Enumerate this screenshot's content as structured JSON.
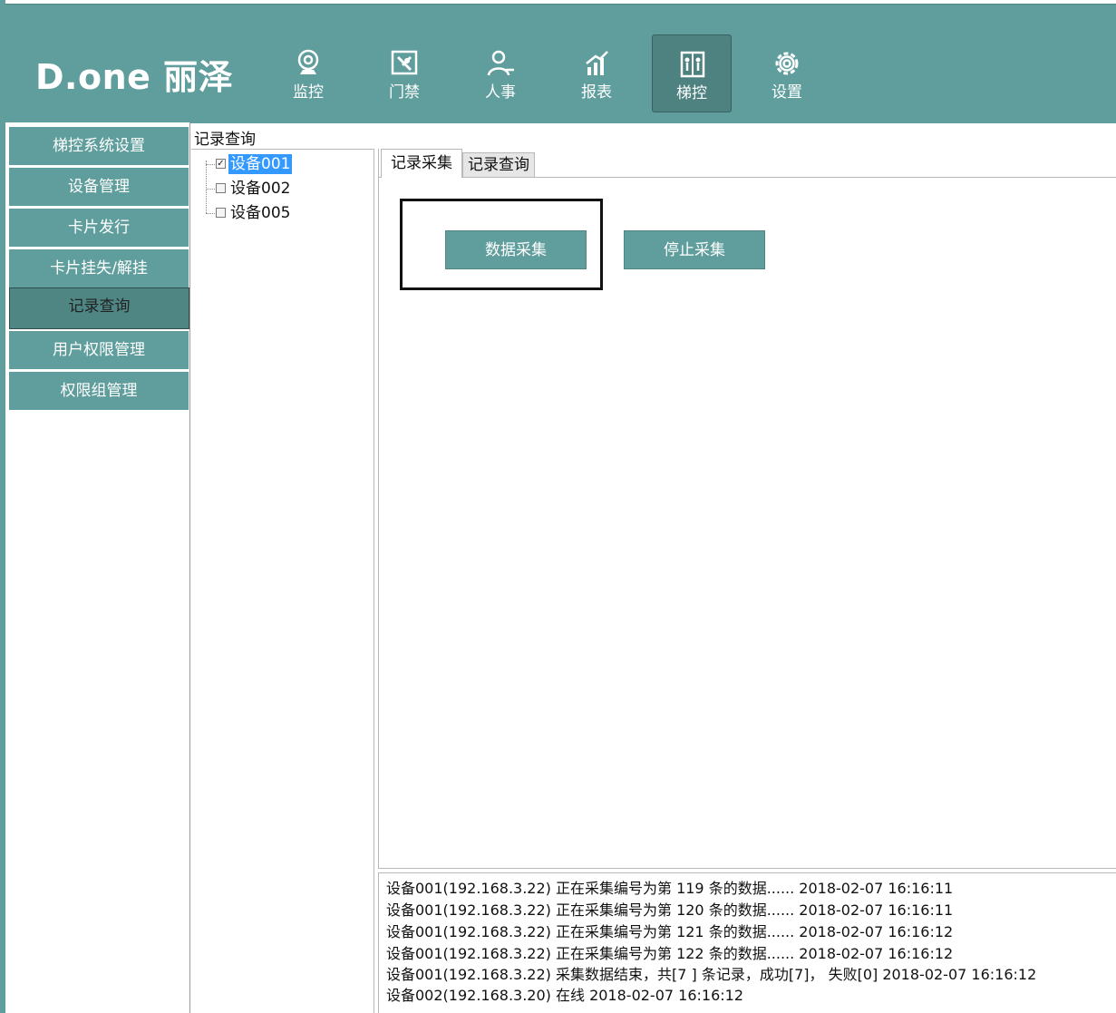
{
  "app": {
    "brand": "D.one 丽泽"
  },
  "nav": [
    {
      "label": "监控",
      "icon": "camera-icon"
    },
    {
      "label": "门禁",
      "icon": "door-access-icon"
    },
    {
      "label": "人事",
      "icon": "person-icon"
    },
    {
      "label": "报表",
      "icon": "bar-chart-icon"
    },
    {
      "label": "梯控",
      "icon": "elevator-icon"
    },
    {
      "label": "设置",
      "icon": "gear-icon"
    }
  ],
  "sidebar": {
    "items": [
      {
        "label": "梯控系统设置"
      },
      {
        "label": "设备管理"
      },
      {
        "label": "卡片发行"
      },
      {
        "label": "卡片挂失/解挂"
      },
      {
        "label": "记录查询"
      },
      {
        "label": "用户权限管理"
      },
      {
        "label": "权限组管理"
      }
    ],
    "active_index": 4
  },
  "panel": {
    "title": "记录查询"
  },
  "tree": {
    "items": [
      {
        "label": "设备001",
        "checked": true,
        "check_mark": "✓"
      },
      {
        "label": "设备002",
        "checked": false,
        "check_mark": ""
      },
      {
        "label": "设备005",
        "checked": false,
        "check_mark": ""
      }
    ]
  },
  "tabs": [
    {
      "label": "记录采集",
      "active": true
    },
    {
      "label": "记录查询",
      "active": false
    }
  ],
  "actions": {
    "collect_label": "数据采集",
    "stop_label": "停止采集"
  },
  "log": [
    "设备001(192.168.3.22) 正在采集编号为第 119 条的数据...... 2018-02-07 16:16:11",
    "设备001(192.168.3.22) 正在采集编号为第 120 条的数据...... 2018-02-07 16:16:11",
    "设备001(192.168.3.22) 正在采集编号为第 121 条的数据...... 2018-02-07 16:16:12",
    "设备001(192.168.3.22) 正在采集编号为第 122 条的数据...... 2018-02-07 16:16:12",
    "设备001(192.168.3.22) 采集数据结束，共[7 ] 条记录，成功[7]， 失败[0] 2018-02-07 16:16:12",
    "设备002(192.168.3.20) 在线 2018-02-07 16:16:12"
  ],
  "colors": {
    "accent": "#5f9e9c",
    "accent_dark": "#4f8684",
    "selection": "#3399ff"
  }
}
